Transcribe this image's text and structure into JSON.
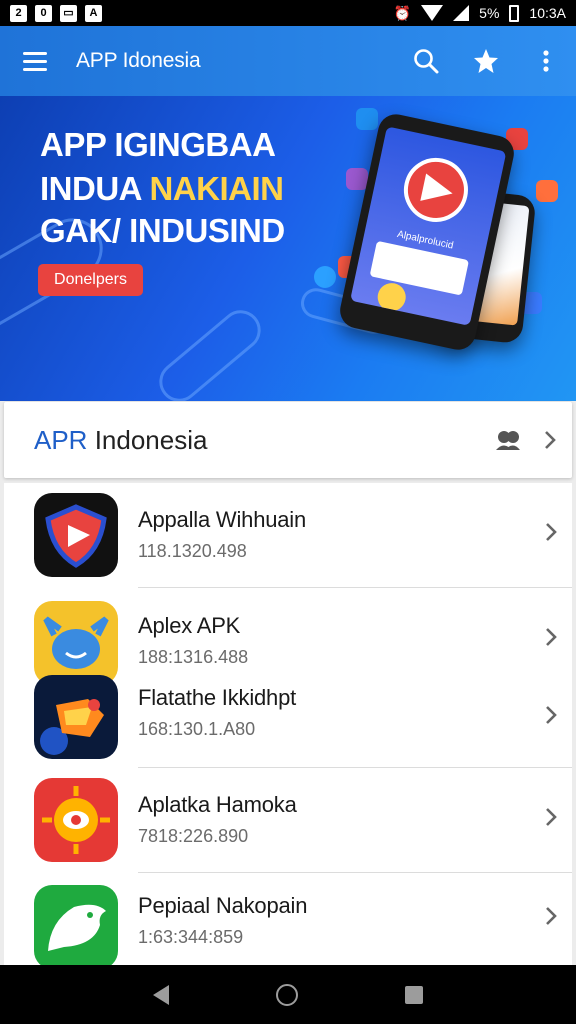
{
  "status_bar": {
    "left_icons": [
      "2",
      "0",
      "▭",
      "A"
    ],
    "battery": "5%",
    "time": "10:3A"
  },
  "app_bar": {
    "title": "APP Idonesia",
    "icons": [
      "menu-icon",
      "search-icon",
      "star-icon",
      "more-vert-icon"
    ]
  },
  "banner": {
    "line1": "APP IGINGBAA",
    "line2_a": "INDUA ",
    "line2_b": "NAKIAIN",
    "line3": "GAK/ INDUSIND",
    "button_label": "Donelpers",
    "phone_text": "Alpalprolucid",
    "accent_color": "#ffd24a",
    "button_color": "#e8433f"
  },
  "section": {
    "title_a": "APR",
    "title_b": " Indonesia",
    "icon": "people-icon"
  },
  "apps": [
    {
      "name": "Appalla Wihhuain",
      "size": "118.1320.498",
      "icon": "red-play-icon",
      "bg": "#111111"
    },
    {
      "name": "Aplex APK",
      "size": "188:1316.488",
      "icon": "blue-monster-icon",
      "bg": "#f4c22b"
    },
    {
      "name": "Flatathe Ikkidhpt",
      "size": "168:130.1.A80",
      "icon": "fire-bird-icon",
      "bg": "#0a1a3a"
    },
    {
      "name": "Aplatka Hamoka",
      "size": "7818:226.890",
      "icon": "sun-eye-icon",
      "bg": "#e53935"
    },
    {
      "name": "Pepiaal Nakopain",
      "size": "1:63:344:859",
      "icon": "bird-icon",
      "bg": "#1faa3f"
    }
  ],
  "nav": [
    "back-icon",
    "home-icon",
    "recents-icon"
  ],
  "colors": {
    "app_bar": "#2585e6",
    "primary_blue": "#1f5fc8"
  }
}
